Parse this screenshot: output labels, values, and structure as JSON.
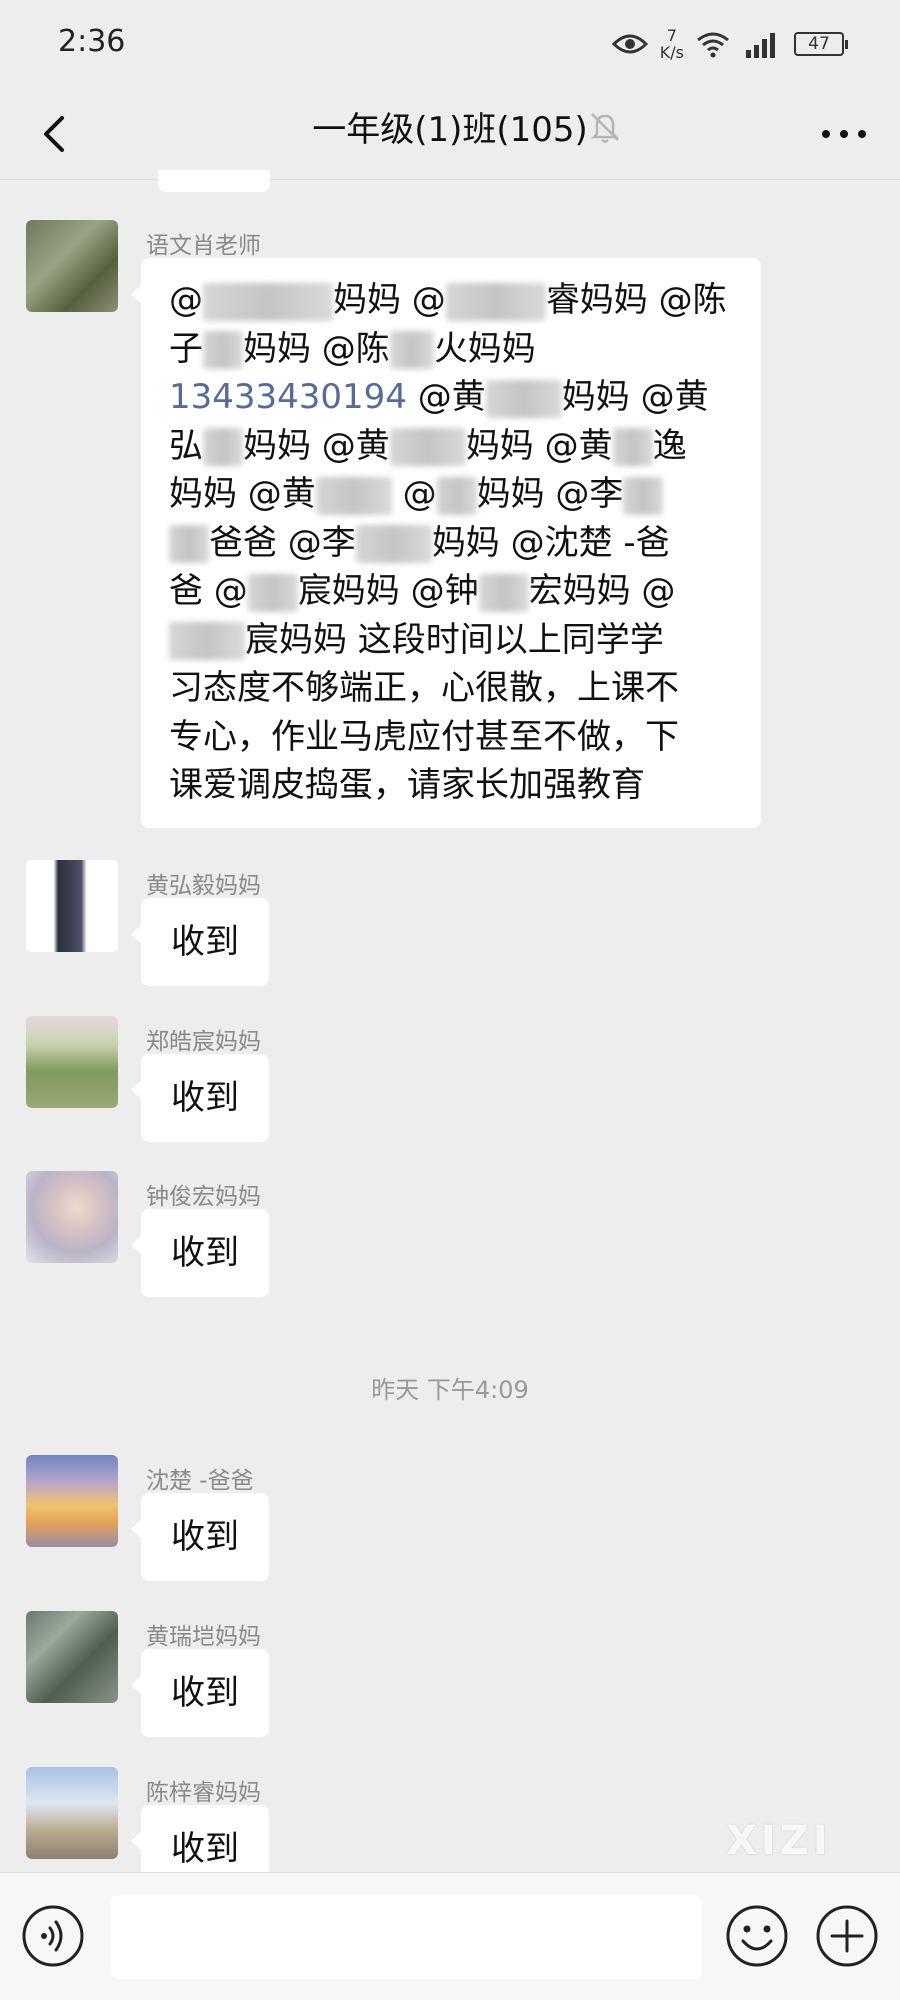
{
  "status_bar": {
    "time": "2:36",
    "net_speed_value": "7",
    "net_speed_unit": "K/s",
    "battery": "47",
    "icons": [
      "eye-icon",
      "wifi-icon",
      "signal-icon",
      "battery-icon"
    ]
  },
  "nav": {
    "title": "一年级(1)班(105)",
    "back_icon": "chevron-left-icon",
    "mute_icon": "bell-off-icon",
    "more_icon": "more-dots-icon"
  },
  "messages": [
    {
      "sender": "语文肖老师",
      "lines": [
        [
          "@",
          "[blur]",
          "妈妈 @",
          "[blur]",
          "睿妈妈 @陈"
        ],
        [
          "子",
          "[blur]",
          "妈妈 @陈",
          "[blur]",
          "火妈妈"
        ],
        [
          "@phone",
          " @黄",
          "[blur]",
          "妈妈 @黄"
        ],
        [
          "弘",
          "[blur]",
          "妈妈 @黄",
          "[blur]",
          "妈妈 @黄",
          "[blur]",
          "逸"
        ],
        [
          "妈妈 @黄",
          "[blur]",
          " @",
          "[blur]",
          "妈妈 @李",
          "[blur]"
        ],
        [
          "[blur]",
          "爸爸 @李",
          "[blur]",
          "妈妈 @沈楚 -爸"
        ],
        [
          "爸 @",
          "[blur]",
          "宸妈妈 @钟",
          "[blur]",
          "宏妈妈 @"
        ],
        [
          "[blur]",
          "宸妈妈 这段时间以上同学学"
        ],
        [
          "习态度不够端正，心很散，上课不"
        ],
        [
          "专心，作业马虎应付甚至不做，下"
        ],
        [
          "课爱调皮捣蛋，请家长加强教育"
        ]
      ],
      "phone": "13433430194"
    },
    {
      "sender": "黄弘毅妈妈",
      "text": "收到"
    },
    {
      "sender": "郑皓宸妈妈",
      "text": "收到"
    },
    {
      "sender": "钟俊宏妈妈",
      "text": "收到"
    },
    {
      "sender": "沈楚 -爸爸",
      "text": "收到"
    },
    {
      "sender": "黄瑞垲妈妈",
      "text": "收到"
    },
    {
      "sender": "陈梓睿妈妈",
      "text": "收到"
    }
  ],
  "time_divider": "昨天 下午4:09",
  "input_bar": {
    "voice_icon": "voice-icon",
    "emoji_icon": "emoji-icon",
    "plus_icon": "plus-circle-icon",
    "input_value": ""
  },
  "watermark": "XIZI",
  "colors": {
    "background": "#ededed",
    "bubble": "#ffffff",
    "link": "#576b95",
    "sender_name": "#8a8a8a"
  }
}
